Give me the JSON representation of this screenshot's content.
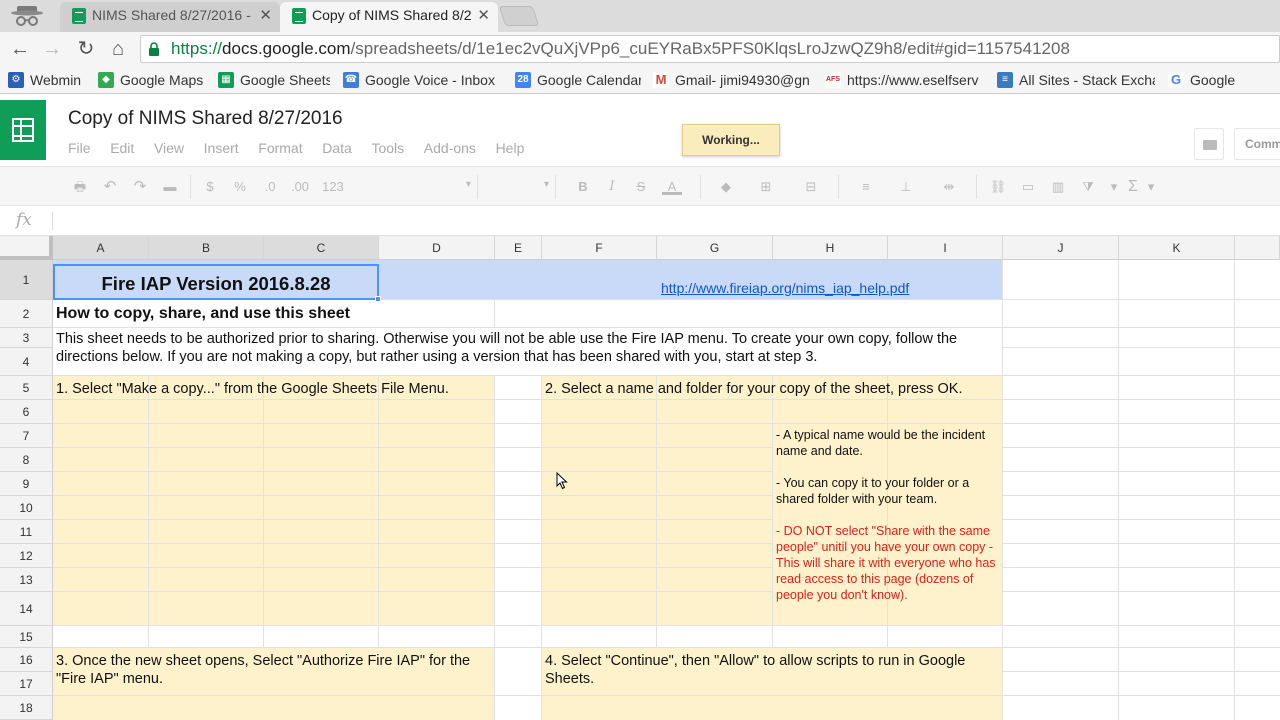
{
  "browser": {
    "tabs": [
      {
        "title": "NIMS Shared 8/27/2016 -",
        "active": false
      },
      {
        "title": "Copy of NIMS Shared 8/2",
        "active": true
      }
    ],
    "url": {
      "scheme": "https://",
      "host": "docs.google.com",
      "path": "/spreadsheets/d/1e1ec2vQuXjVPp6_cuEYRaBx5PFS0KlqsLroJzwQZ9h8/edit#gid=1157541208"
    },
    "bookmarks": [
      {
        "label": "Webmin",
        "icon": "webmin-icon",
        "color": "#2d5fb8"
      },
      {
        "label": "Google Maps",
        "icon": "maps-icon",
        "color": "#34a853"
      },
      {
        "label": "Google Sheets",
        "icon": "sheets-icon",
        "color": "#0f9d58"
      },
      {
        "label": "Google Voice - Inbox",
        "icon": "voice-icon",
        "color": "#3c7ee0"
      },
      {
        "label": "Google Calendar",
        "icon": "calendar-icon",
        "color": "#4285f4",
        "glyph": "28"
      },
      {
        "label": "Gmail- jimi94930@gn",
        "icon": "gmail-icon",
        "color": "#db4437",
        "glyph": "M"
      },
      {
        "label": "https://www.eselfserv",
        "icon": "afs-icon",
        "color": "#c62828",
        "glyph": "AFS"
      },
      {
        "label": "All Sites - Stack Excha",
        "icon": "stack-exchange-icon",
        "color": "#3b7bbf"
      },
      {
        "label": "Google",
        "icon": "google-icon",
        "color": "#4285f4",
        "glyph": "G"
      }
    ]
  },
  "doc": {
    "title": "Copy of NIMS Shared 8/27/2016",
    "menu": [
      "File",
      "Edit",
      "View",
      "Insert",
      "Format",
      "Data",
      "Tools",
      "Add-ons",
      "Help"
    ],
    "working": "Working...",
    "comments_label": "Comm"
  },
  "toolbar": {
    "currency": "$",
    "percent": "%",
    "dec_less": ".0",
    "dec_more": ".00",
    "format_more": "123",
    "bold": "B",
    "italic": "I",
    "strike": "S",
    "text_color": "A",
    "functions": "Σ"
  },
  "formula": {
    "label": "fx",
    "value": ""
  },
  "columns": [
    "A",
    "B",
    "C",
    "D",
    "E",
    "F",
    "G",
    "H",
    "I",
    "J",
    "K"
  ],
  "rows": [
    "1",
    "2",
    "3",
    "4",
    "5",
    "6",
    "7",
    "8",
    "9",
    "10",
    "11",
    "12",
    "13",
    "14",
    "15",
    "16",
    "17",
    "18"
  ],
  "cells": {
    "a1": "Fire IAP Version 2016.8.28",
    "g1_link": "http://www.fireiap.org/nims_iap_help.pdf",
    "a2": "How to copy, share, and use this sheet",
    "a3": "This sheet needs to be authorized prior to sharing. Otherwise you will not be able use the Fire IAP menu. To create your own copy, follow the directions below. If you are not making a copy, but rather using a version that has been shared with you, start at step 3.",
    "a5": "1. Select \"Make a copy...\" from the Google Sheets File Menu.",
    "f5": "2. Select a name and folder for your copy of the sheet, press OK.",
    "h7": "- A typical name would be the incident name and date.",
    "h9": "- You can copy it to your folder or a shared folder with your team.",
    "h11": "- DO NOT select \"Share with the same people\" unitil you have your own copy - This will share it with everyone who has read access to this page (dozens of people you don't know).",
    "a16": "3. Once the new sheet opens, Select \"Authorize Fire IAP\" for the \"Fire IAP\" menu.",
    "f16": "4. Select \"Continue\", then \"Allow\" to allow scripts to run in Google Sheets."
  },
  "colors": {
    "yellow_fill": "#fdf2cc",
    "blue_fill": "#c9daf8",
    "selection": "#4d90fe",
    "warning_text": "#e0201a",
    "link": "#1155cc"
  }
}
